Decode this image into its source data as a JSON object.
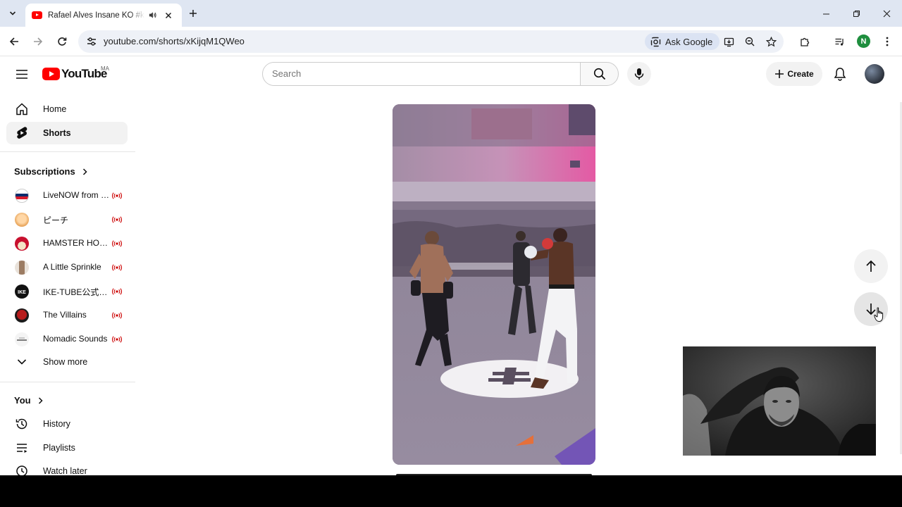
{
  "browser": {
    "tab": {
      "title": "Rafael Alves Insane KO #karate #mma #ufc",
      "audio_icon": "speaker-icon",
      "close_icon": "close-icon"
    },
    "url": "youtube.com/shorts/xKijqM1QWeo",
    "ask_google_label": "Ask Google",
    "profile_initial": "N",
    "profile_color": "#1e8e3e"
  },
  "youtube": {
    "logo_text": "YouTube",
    "country_code": "MA",
    "search_placeholder": "Search",
    "create_label": "Create",
    "brand_color": "#ff0000"
  },
  "sidebar": {
    "nav": [
      {
        "label": "Home",
        "icon": "home-icon",
        "active": false
      },
      {
        "label": "Shorts",
        "icon": "shorts-icon",
        "active": true
      }
    ],
    "subscriptions_title": "Subscriptions",
    "subscriptions": [
      {
        "name": "LiveNOW from FOX",
        "live": true
      },
      {
        "name": "ピーチ",
        "live": true
      },
      {
        "name": "HAMSTER HOUSE",
        "live": true
      },
      {
        "name": "A Little Sprinkle",
        "live": true
      },
      {
        "name": "IKE-TUBE公式CH",
        "live": true
      },
      {
        "name": "The Villains",
        "live": true
      },
      {
        "name": "Nomadic Sounds",
        "live": true
      }
    ],
    "show_more_label": "Show more",
    "you_title": "You",
    "you_items": [
      {
        "label": "History",
        "icon": "history-icon"
      },
      {
        "label": "Playlists",
        "icon": "playlists-icon"
      },
      {
        "label": "Watch later",
        "icon": "watch-later-icon"
      }
    ],
    "live_color": "#cc0000"
  },
  "shorts": {
    "prev_icon": "arrow-up-icon",
    "next_icon": "arrow-down-icon"
  }
}
